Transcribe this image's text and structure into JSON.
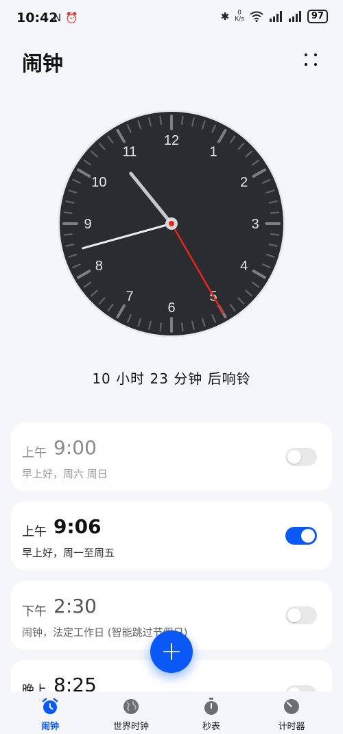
{
  "status_bar": {
    "time": "10:42",
    "left_icons": [
      "nfc-icon",
      "alarm-status-icon"
    ],
    "right_icons": [
      "bluetooth-icon",
      "wifi-icon",
      "signal-icon",
      "signal-icon"
    ],
    "net_speed_value": "0",
    "net_speed_unit": "K/s",
    "battery": "97"
  },
  "header": {
    "title": "闹钟",
    "more_icon": "more-icon"
  },
  "clock": {
    "numerals": [
      "12",
      "1",
      "2",
      "3",
      "4",
      "5",
      "6",
      "7",
      "8",
      "9",
      "10",
      "11"
    ],
    "hour": 10,
    "minute": 42,
    "second": 25,
    "second_hand_color": "#e8261b"
  },
  "countdown_text": "10 小时 23 分钟 后响铃",
  "alarms": [
    {
      "period": "上午",
      "time": "9:00",
      "description": "早上好，周六 周日",
      "enabled": false
    },
    {
      "period": "上午",
      "time": "9:06",
      "description": "早上好，周一至周五",
      "enabled": true
    },
    {
      "period": "下午",
      "time": "2:30",
      "description": "闹钟，法定工作日 (智能跳过节假日)",
      "enabled": false
    },
    {
      "period": "晚上",
      "time": "8:25",
      "description": "",
      "enabled": false
    }
  ],
  "fab": {
    "label": "+"
  },
  "colors": {
    "accent": "#0a59f7",
    "background": "#f4f6fa"
  },
  "bottom_nav": [
    {
      "label": "闹钟",
      "icon": "alarm-clock-icon",
      "active": true
    },
    {
      "label": "世界时钟",
      "icon": "globe-icon",
      "active": false
    },
    {
      "label": "秒表",
      "icon": "stopwatch-icon",
      "active": false
    },
    {
      "label": "计时器",
      "icon": "timer-icon",
      "active": false
    }
  ]
}
